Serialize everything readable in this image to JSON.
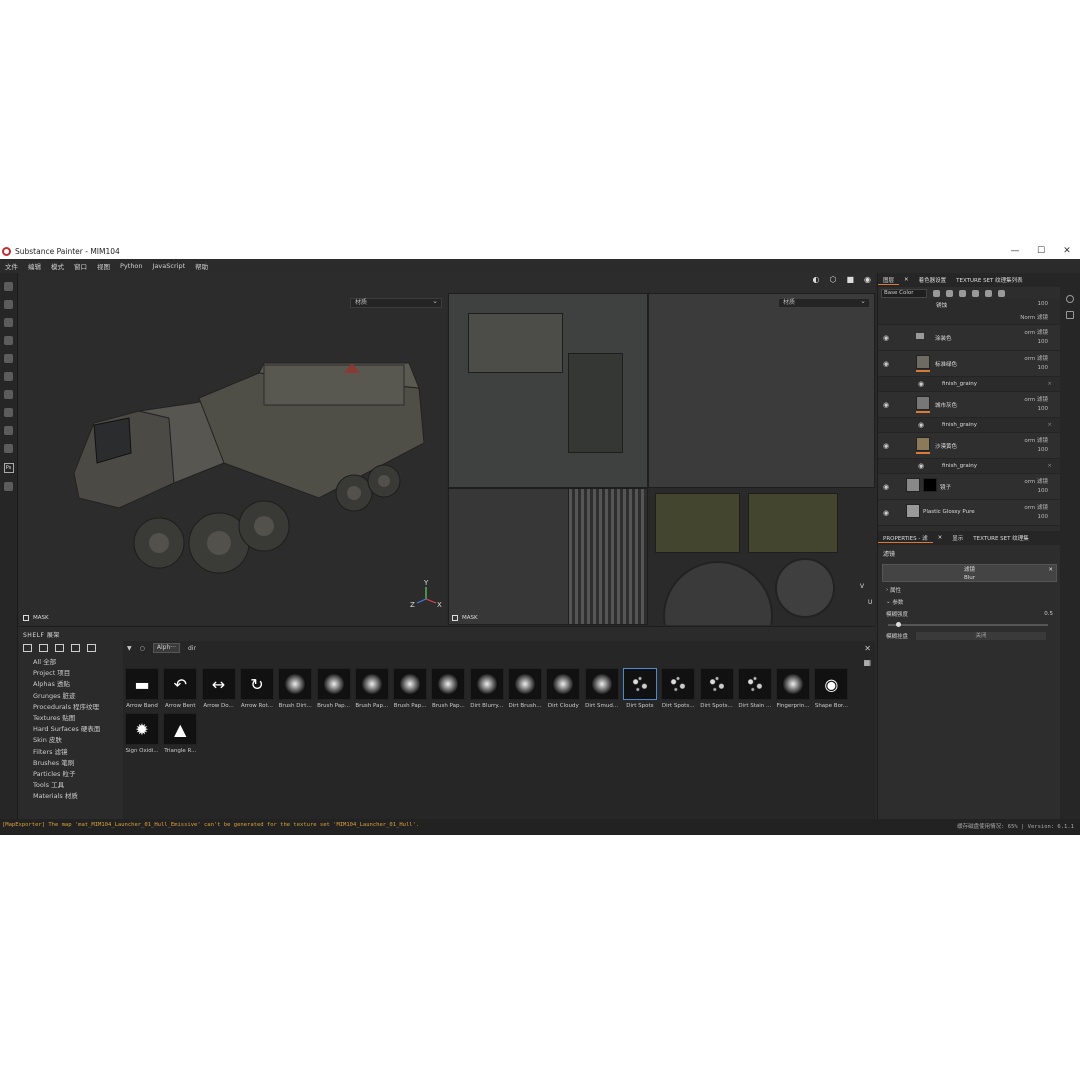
{
  "window": {
    "title": "Substance Painter - MIM104",
    "controls": [
      "—",
      "☐",
      "✕"
    ]
  },
  "menu": [
    "文件",
    "编辑",
    "模式",
    "窗口",
    "视图",
    "Python",
    "JavaScript",
    "帮助"
  ],
  "viewport3d": {
    "dropdown": "材质",
    "mask_label": "MASK",
    "axes": {
      "y": "Y",
      "z": "Z",
      "x": "X"
    }
  },
  "viewport2d": {
    "dropdown": "材质",
    "mask_label": "MASK",
    "v_label": "V",
    "u_label": "U"
  },
  "toolbar_icons": [
    "camera-icon",
    "cube-icon",
    "video-icon",
    "screenshot-icon"
  ],
  "layers_panel": {
    "tabs": [
      "图层",
      "着色器设置",
      "TEXTURE SET 纹理集列表"
    ],
    "channel": "Base Color",
    "layers": [
      {
        "name": "锈蚀",
        "blend": "Norm 滤镜",
        "opacity": "100",
        "type": "sub"
      },
      {
        "name": "涂装色",
        "blend": "orm 滤镜",
        "opacity": "100",
        "type": "folder"
      },
      {
        "name": "标准绿色",
        "blend": "orm 滤镜",
        "opacity": "100",
        "type": "layer"
      },
      {
        "name": "finish_grainy",
        "type": "sub"
      },
      {
        "name": "城市灰色",
        "blend": "orm 滤镜",
        "opacity": "100",
        "type": "layer"
      },
      {
        "name": "finish_grainy",
        "type": "sub"
      },
      {
        "name": "沙漠黄色",
        "blend": "orm 滤镜",
        "opacity": "100",
        "type": "layer"
      },
      {
        "name": "finish_grainy",
        "type": "sub"
      },
      {
        "name": "镜子",
        "blend": "orm 滤镜",
        "opacity": "100",
        "type": "layer"
      },
      {
        "name": "Plastic Glossy Pure",
        "blend": "orm 滤镜",
        "opacity": "100",
        "type": "layer"
      }
    ]
  },
  "properties": {
    "tabs": [
      "PROPERTIES - 滤",
      "显示",
      "TEXTURE SET 纹理集"
    ],
    "section": "滤镜",
    "filter_title": "滤镜",
    "filter_name": "Blur",
    "attr_label": "属性",
    "params_label": "参数",
    "blur_label": "模糊强度",
    "blur_value": "0.5",
    "blur_level": 0.05,
    "dir_label": "模糊挂盘",
    "dir_value": "关闭"
  },
  "shelf": {
    "title": "SHELF 展架",
    "search_chip": "Alph···",
    "search_text": "dir",
    "categories": [
      "All 全部",
      "Project 项目",
      "Alphas 透贴",
      "Grunges 脏迹",
      "Procedurals 程序纹理",
      "Textures 贴图",
      "Hard Surfaces 硬表面",
      "Skin 皮肤",
      "Filters 滤镜",
      "Brushes 笔刷",
      "Particles 粒子",
      "Tools 工具",
      "Materials 材质"
    ],
    "items": [
      "Arrow Band",
      "Arrow Bent",
      "Arrow Do...",
      "Arrow Rot...",
      "Brush Dirt...",
      "Brush Pap...",
      "Brush Pap...",
      "Brush Pap...",
      "Brush Pap...",
      "Dirt Blurry...",
      "Dirt Brush...",
      "Dirt Cloudy",
      "Dirt Smud...",
      "Dirt Spots",
      "Dirt Spots...",
      "Dirt Spots...",
      "Dirt Stain ...",
      "Fingerprin...",
      "Shape Bor...",
      "Sign Oxidi...",
      "Triangle R..."
    ],
    "selected": "Dirt Spots"
  },
  "status": {
    "error": "[MapExporter] The map 'mat_MIM104_Launcher_01_Hull_Emissive' can't be generated for the texture set 'MIM104_Launcher_01_Hull'.",
    "right": "缓存磁盘使用情况: 65% | Version: 6.1.1"
  }
}
